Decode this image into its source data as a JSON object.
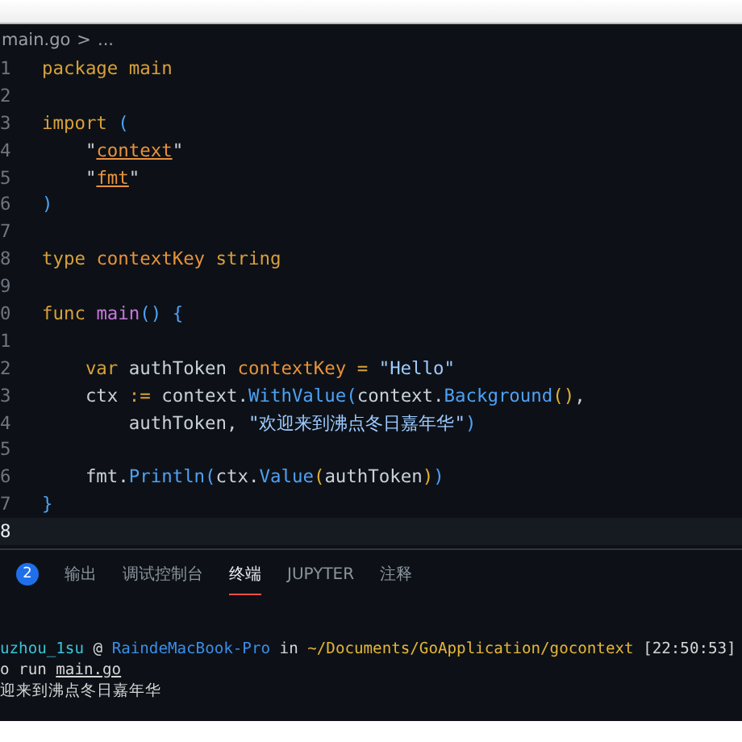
{
  "breadcrumb": {
    "file": "main.go",
    "separator": ">",
    "more": "..."
  },
  "editor": {
    "lines": [
      {
        "number": "1",
        "current": false,
        "tokens": [
          {
            "text": "package ",
            "kind": "keyword"
          },
          {
            "text": "main",
            "kind": "keyword"
          }
        ]
      },
      {
        "number": "2",
        "current": false
      },
      {
        "number": "3",
        "current": false,
        "tokens": [
          {
            "text": "import ",
            "kind": "keyword"
          },
          {
            "text": "(",
            "kind": "bracket"
          }
        ]
      },
      {
        "number": "4",
        "current": false,
        "tokens": [
          {
            "text": "    \""
          },
          {
            "text": "context",
            "kind": "link"
          },
          {
            "text": "\""
          }
        ]
      },
      {
        "number": "5",
        "current": false,
        "tokens": [
          {
            "text": "    \""
          },
          {
            "text": "fmt",
            "kind": "link"
          },
          {
            "text": "\""
          }
        ]
      },
      {
        "number": "6",
        "current": false,
        "tokens": [
          {
            "text": ")",
            "kind": "bracket"
          }
        ]
      },
      {
        "number": "7",
        "current": false
      },
      {
        "number": "8",
        "current": false,
        "tokens": [
          {
            "text": "type ",
            "kind": "keyword"
          },
          {
            "text": "contextKey ",
            "kind": "type"
          },
          {
            "text": "string",
            "kind": "keyword"
          }
        ]
      },
      {
        "number": "9",
        "current": false
      },
      {
        "number": "0",
        "current": false,
        "tokens": [
          {
            "text": "func ",
            "kind": "keyword"
          },
          {
            "text": "main",
            "kind": "entry"
          },
          {
            "text": "() {",
            "kind": "bracket"
          }
        ]
      },
      {
        "number": "1",
        "current": false
      },
      {
        "number": "2",
        "current": false,
        "tokens": [
          {
            "text": "    var ",
            "kind": "keyword"
          },
          {
            "text": "authToken "
          },
          {
            "text": "contextKey ",
            "kind": "type"
          },
          {
            "text": "= ",
            "kind": "keyword"
          },
          {
            "text": "\"Hello\"",
            "kind": "string"
          }
        ]
      },
      {
        "number": "3",
        "current": false,
        "tokens": [
          {
            "text": "    ctx "
          },
          {
            "text": ":=",
            "kind": "keyword"
          },
          {
            "text": " context."
          },
          {
            "text": "WithValue",
            "kind": "function"
          },
          {
            "text": "(",
            "kind": "bracket"
          },
          {
            "text": "context."
          },
          {
            "text": "Background",
            "kind": "function"
          },
          {
            "text": "()",
            "kind": "bracket2"
          },
          {
            "text": ","
          }
        ]
      },
      {
        "number": "4",
        "current": false,
        "tokens": [
          {
            "text": "        authToken, "
          },
          {
            "text": "\"欢迎来到沸点冬日嘉年华\"",
            "kind": "string"
          },
          {
            "text": ")",
            "kind": "bracket"
          }
        ]
      },
      {
        "number": "5",
        "current": false
      },
      {
        "number": "6",
        "current": false,
        "tokens": [
          {
            "text": "    fmt."
          },
          {
            "text": "Println",
            "kind": "function"
          },
          {
            "text": "(",
            "kind": "bracket"
          },
          {
            "text": "ctx."
          },
          {
            "text": "Value",
            "kind": "function"
          },
          {
            "text": "(",
            "kind": "bracket2"
          },
          {
            "text": "authToken"
          },
          {
            "text": ")",
            "kind": "bracket2"
          },
          {
            "text": ")",
            "kind": "bracket"
          }
        ]
      },
      {
        "number": "7",
        "current": false,
        "tokens": [
          {
            "text": "}",
            "kind": "bracket"
          }
        ]
      },
      {
        "number": "8",
        "current": true
      }
    ]
  },
  "panel": {
    "badge": "2",
    "tabs": [
      {
        "label": "输出",
        "selected": false
      },
      {
        "label": "调试控制台",
        "selected": false
      },
      {
        "label": "终端",
        "selected": true
      },
      {
        "label": "JUPYTER",
        "selected": false
      },
      {
        "label": "注释",
        "selected": false
      }
    ]
  },
  "terminal": {
    "lines": [
      [
        {
          "text": "uzhou_1su",
          "kind": "user"
        },
        {
          "text": " @ "
        },
        {
          "text": "RaindeMacBook-Pro",
          "kind": "host"
        },
        {
          "text": " in "
        },
        {
          "text": "~/Documents/GoApplication/gocontext",
          "kind": "path"
        },
        {
          "text": " [22:50:53]"
        }
      ],
      [
        {
          "text": "o run "
        },
        {
          "text": "main.go",
          "kind": "link"
        }
      ],
      [
        {
          "text": "迎来到沸点冬日嘉年华"
        }
      ]
    ]
  }
}
